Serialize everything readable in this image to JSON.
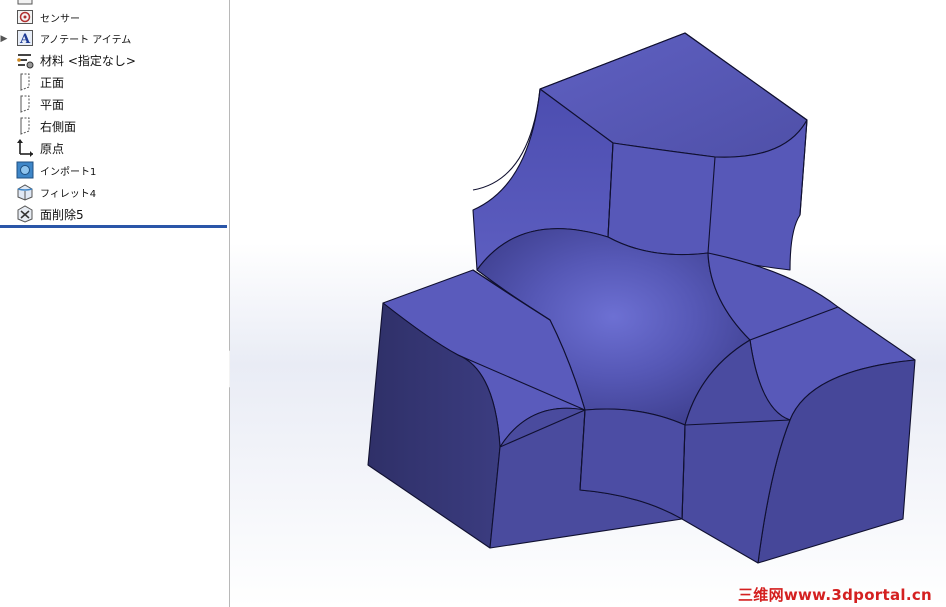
{
  "feature_tree": {
    "items": [
      {
        "label": "センサー",
        "icon": "sensor-icon",
        "small": true
      },
      {
        "label": "アノテート アイテム",
        "icon": "annotation-icon",
        "small": true,
        "expandable": true
      },
      {
        "label": "材料 <指定なし>",
        "icon": "material-icon",
        "small": false
      },
      {
        "label": "正面",
        "icon": "plane-icon",
        "small": false
      },
      {
        "label": "平面",
        "icon": "plane-icon",
        "small": false
      },
      {
        "label": "右側面",
        "icon": "plane-icon",
        "small": false
      },
      {
        "label": "原点",
        "icon": "origin-icon",
        "small": false
      },
      {
        "label": "インポート1",
        "icon": "import-icon",
        "small": true
      },
      {
        "label": "フィレット4",
        "icon": "fillet-icon",
        "small": true
      },
      {
        "label": "面削除5",
        "icon": "delete-face-icon",
        "small": false
      }
    ]
  },
  "model": {
    "color": "#5b5cb8"
  },
  "watermark": "三维网www.3dportal.cn"
}
